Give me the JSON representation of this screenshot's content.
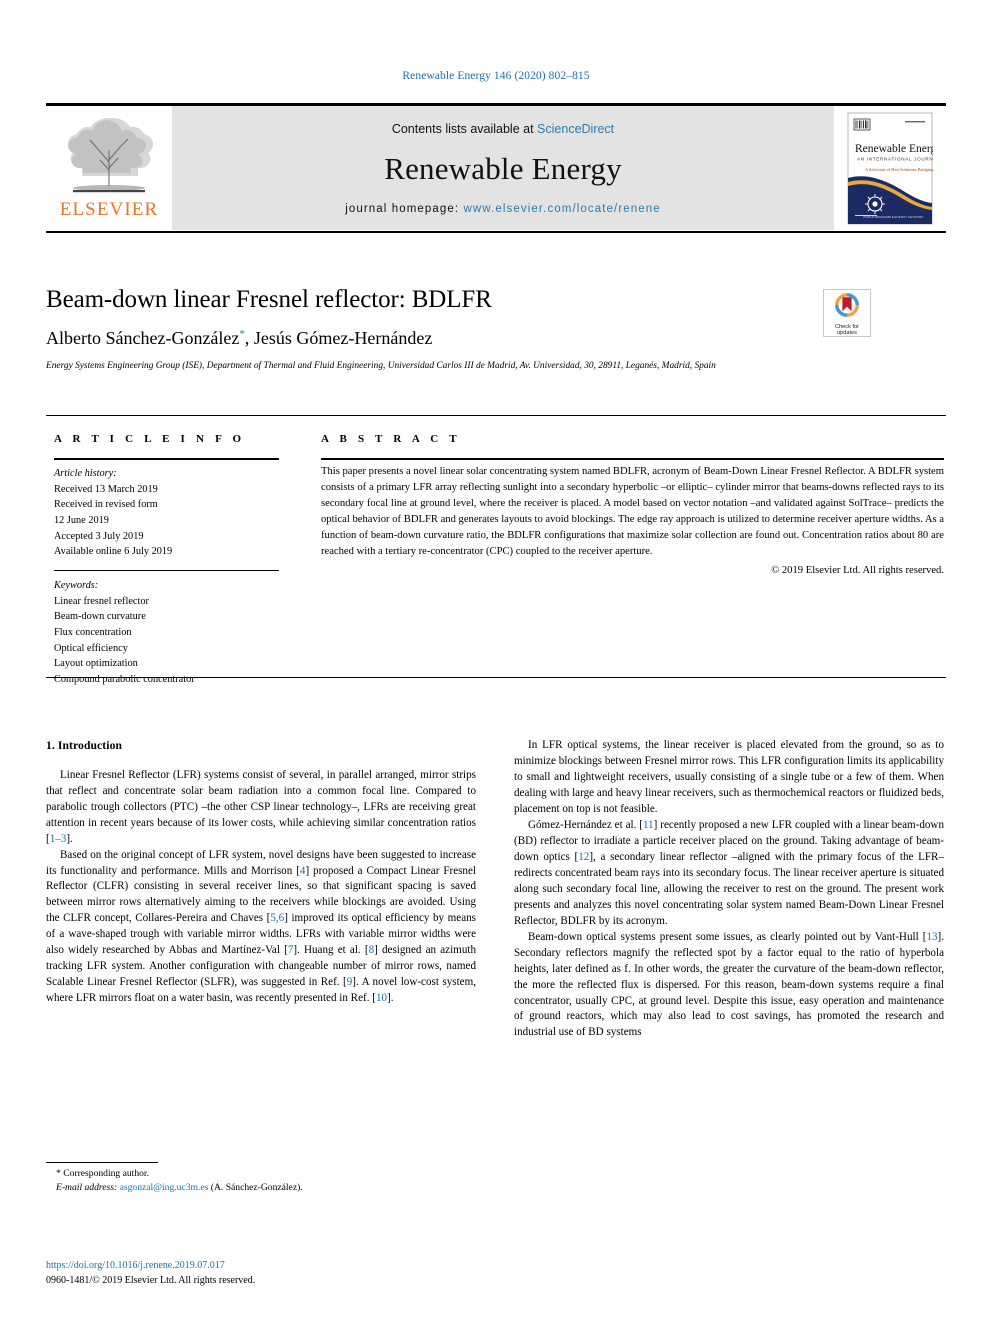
{
  "running_head": "Renewable Energy 146 (2020) 802–815",
  "masthead": {
    "contents_prefix": "Contents lists available at",
    "sciencedirect": "ScienceDirect",
    "journal_title": "Renewable Energy",
    "homepage_label": "journal homepage:",
    "homepage_url": "www.elsevier.com/locate/renene",
    "publisher_wordmark": "ELSEVIER",
    "publisher_logo_icon": "elsevier-tree-icon",
    "cover_icon": "journal-cover-thumbnail",
    "cover_title": "Renewable Energy",
    "cover_subtitle": "AN INTERNATIONAL JOURNAL",
    "accent_orange": "#E87722",
    "link_blue": "#2a7ab0",
    "band_grey": "#e3e3e3"
  },
  "crossmark": {
    "icon": "crossmark-check-for-updates-icon",
    "line1": "Check for",
    "line2": "updates"
  },
  "article": {
    "title": "Beam-down linear Fresnel reflector: BDLFR",
    "authors": "Alberto Sánchez-González",
    "author_marker": "*",
    "authors_rest": ", Jesús Gómez-Hernández",
    "affiliation": "Energy Systems Engineering Group (ISE), Department of Thermal and Fluid Engineering, Universidad Carlos III de Madrid, Av. Universidad, 30, 28911, Leganés, Madrid, Spain"
  },
  "info": {
    "heading": "A R T I C L E  I N F O",
    "history_label": "Article history:",
    "history": [
      "Received 13 March 2019",
      "Received in revised form",
      "12 June 2019",
      "Accepted 3 July 2019",
      "Available online 6 July 2019"
    ],
    "keywords_label": "Keywords:",
    "keywords": [
      "Linear fresnel reflector",
      "Beam-down curvature",
      "Flux concentration",
      "Optical efficiency",
      "Layout optimization",
      "Compound parabolic concentrator"
    ]
  },
  "abstract": {
    "heading": "A B S T R A C T",
    "text": "This paper presents a novel linear solar concentrating system named BDLFR, acronym of Beam-Down Linear Fresnel Reflector. A BDLFR system consists of a primary LFR array reflecting sunlight into a secondary hyperbolic –or elliptic– cylinder mirror that beams-downs reflected rays to its secondary focal line at ground level, where the receiver is placed. A model based on vector notation –and validated against SolTrace– predicts the optical behavior of BDLFR and generates layouts to avoid blockings. The edge ray approach is utilized to determine receiver aperture widths. As a function of beam-down curvature ratio, the BDLFR configurations that maximize solar collection are found out. Concentration ratios about 80 are reached with a tertiary re-concentrator (CPC) coupled to the receiver aperture.",
    "copyright": "© 2019 Elsevier Ltd. All rights reserved."
  },
  "body": {
    "section_number_title": "1. Introduction",
    "left_paragraphs": [
      {
        "segments": [
          {
            "t": "Linear Fresnel Reflector (LFR) systems consist of several, in parallel arranged, mirror strips that reflect and concentrate solar beam radiation into a common focal line. Compared to parabolic trough collectors (PTC) –the other CSP linear technology–, LFRs are receiving great attention in recent years because of its lower costs, while achieving similar concentration ratios ["
          },
          {
            "t": "1–3",
            "ref": true
          },
          {
            "t": "]."
          }
        ]
      },
      {
        "segments": [
          {
            "t": "Based on the original concept of LFR system, novel designs have been suggested to increase its functionality and performance. Mills and Morrison ["
          },
          {
            "t": "4",
            "ref": true
          },
          {
            "t": "] proposed a Compact Linear Fresnel Reflector (CLFR) consisting in several receiver lines, so that significant spacing is saved between mirror rows alternatively aiming to the receivers while blockings are avoided. Using the CLFR concept, Collares-Pereira and Chaves ["
          },
          {
            "t": "5,6",
            "ref": true
          },
          {
            "t": "] improved its optical efficiency by means of a wave-shaped trough with variable mirror widths. LFRs with variable mirror widths were also widely researched by Abbas and Martínez-Val ["
          },
          {
            "t": "7",
            "ref": true
          },
          {
            "t": "]. Huang et al. ["
          },
          {
            "t": "8",
            "ref": true
          },
          {
            "t": "] designed an azimuth tracking LFR system. Another configuration with changeable number of mirror rows, named Scalable Linear Fresnel Reflector (SLFR), was suggested in Ref. ["
          },
          {
            "t": "9",
            "ref": true
          },
          {
            "t": "]. A novel low-cost system, where LFR mirrors float on a water basin, was recently presented in Ref. ["
          },
          {
            "t": "10",
            "ref": true
          },
          {
            "t": "]."
          }
        ]
      }
    ],
    "right_paragraphs": [
      {
        "segments": [
          {
            "t": "In LFR optical systems, the linear receiver is placed elevated from the ground, so as to minimize blockings between Fresnel mirror rows. This LFR configuration limits its applicability to small and lightweight receivers, usually consisting of a single tube or a few of them. When dealing with large and heavy linear receivers, such as thermochemical reactors or fluidized beds, placement on top is not feasible."
          }
        ]
      },
      {
        "segments": [
          {
            "t": "Gómez-Hernández et al. ["
          },
          {
            "t": "11",
            "ref": true
          },
          {
            "t": "] recently proposed a new LFR coupled with a linear beam-down (BD) reflector to irradiate a particle receiver placed on the ground. Taking advantage of beam-down optics ["
          },
          {
            "t": "12",
            "ref": true
          },
          {
            "t": "], a secondary linear reflector –aligned with the primary focus of the LFR– redirects concentrated beam rays into its secondary focus. The linear receiver aperture is situated along such secondary focal line, allowing the receiver to rest on the ground. The present work presents and analyzes this novel concentrating solar system named Beam-Down Linear Fresnel Reflector, BDLFR by its acronym."
          }
        ]
      },
      {
        "segments": [
          {
            "t": "Beam-down optical systems present some issues, as clearly pointed out by Vant-Hull ["
          },
          {
            "t": "13",
            "ref": true
          },
          {
            "t": "]. Secondary reflectors magnify the reflected spot by a factor equal to the ratio of hyperbola heights, later defined as f. In other words, the greater the curvature of the beam-down reflector, the more the reflected flux is dispersed. For this reason, beam-down systems require a final concentrator, usually CPC, at ground level. Despite this issue, easy operation and maintenance of ground reactors, which may also lead to cost savings, has promoted the research and industrial use of BD systems"
          }
        ]
      }
    ]
  },
  "footnote": {
    "corresponding": "* Corresponding author.",
    "email_label": "E-mail address:",
    "email": "asgonzal@ing.uc3m.es",
    "email_suffix": "(A. Sánchez-González)."
  },
  "footer": {
    "doi": "https://doi.org/10.1016/j.renene.2019.07.017",
    "issn_line": "0960-1481/© 2019 Elsevier Ltd. All rights reserved."
  }
}
